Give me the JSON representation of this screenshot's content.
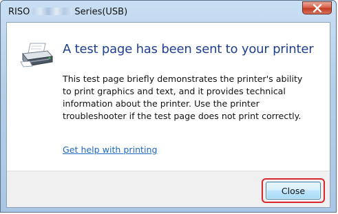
{
  "window": {
    "title_prefix": "RISO",
    "title_suffix": "Series(USB)",
    "close_icon": "close-icon"
  },
  "dialog": {
    "icon": "printer-icon",
    "heading": "A test page has been sent to your printer",
    "body_lines": [
      "This test page briefly demonstrates the printer's ability",
      "to print graphics and text, and it provides technical",
      "information about the printer. Use the printer",
      "troubleshooter if the test page does not print correctly."
    ],
    "help_link": "Get help with printing"
  },
  "footer": {
    "close_label": "Close"
  },
  "colors": {
    "heading": "#1e3f91",
    "link": "#1c68c6",
    "highlight": "#d9262a",
    "close_x": "#c23b22"
  }
}
